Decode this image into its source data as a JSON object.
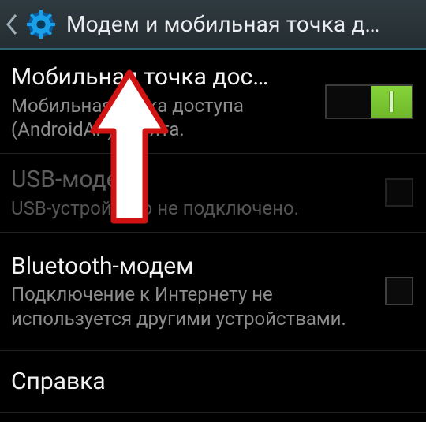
{
  "actionbar": {
    "title": "Модем и мобильная точка д…"
  },
  "rows": [
    {
      "title": "Мобильная точка дос…",
      "subtitle": "Мобильная точка доступа (AndroidAP) занята.",
      "enabled": true,
      "control": "switch",
      "switch_on": true
    },
    {
      "title": "USB-модем",
      "subtitle": "USB-устройство не подключено.",
      "enabled": false,
      "control": "checkbox",
      "checked": false
    },
    {
      "title": "Bluetooth-модем",
      "subtitle": "Подключение к Интернету не используется другими устройствами.",
      "enabled": true,
      "control": "checkbox",
      "checked": false
    },
    {
      "title": "Справка",
      "subtitle": "",
      "enabled": true,
      "control": "none"
    }
  ]
}
